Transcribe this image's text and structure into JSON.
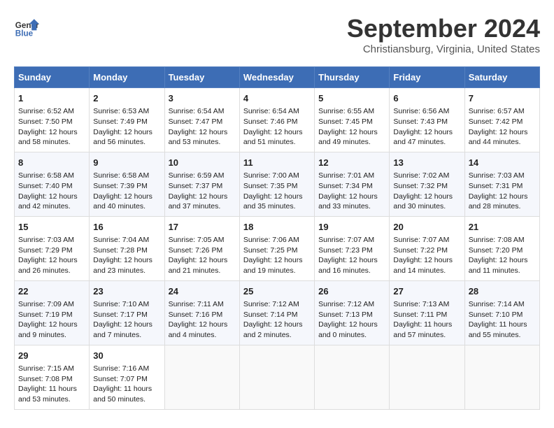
{
  "header": {
    "logo_line1": "General",
    "logo_line2": "Blue",
    "month": "September 2024",
    "location": "Christiansburg, Virginia, United States"
  },
  "days_of_week": [
    "Sunday",
    "Monday",
    "Tuesday",
    "Wednesday",
    "Thursday",
    "Friday",
    "Saturday"
  ],
  "weeks": [
    [
      {
        "num": "1",
        "lines": [
          "Sunrise: 6:52 AM",
          "Sunset: 7:50 PM",
          "Daylight: 12 hours",
          "and 58 minutes."
        ]
      },
      {
        "num": "2",
        "lines": [
          "Sunrise: 6:53 AM",
          "Sunset: 7:49 PM",
          "Daylight: 12 hours",
          "and 56 minutes."
        ]
      },
      {
        "num": "3",
        "lines": [
          "Sunrise: 6:54 AM",
          "Sunset: 7:47 PM",
          "Daylight: 12 hours",
          "and 53 minutes."
        ]
      },
      {
        "num": "4",
        "lines": [
          "Sunrise: 6:54 AM",
          "Sunset: 7:46 PM",
          "Daylight: 12 hours",
          "and 51 minutes."
        ]
      },
      {
        "num": "5",
        "lines": [
          "Sunrise: 6:55 AM",
          "Sunset: 7:45 PM",
          "Daylight: 12 hours",
          "and 49 minutes."
        ]
      },
      {
        "num": "6",
        "lines": [
          "Sunrise: 6:56 AM",
          "Sunset: 7:43 PM",
          "Daylight: 12 hours",
          "and 47 minutes."
        ]
      },
      {
        "num": "7",
        "lines": [
          "Sunrise: 6:57 AM",
          "Sunset: 7:42 PM",
          "Daylight: 12 hours",
          "and 44 minutes."
        ]
      }
    ],
    [
      {
        "num": "8",
        "lines": [
          "Sunrise: 6:58 AM",
          "Sunset: 7:40 PM",
          "Daylight: 12 hours",
          "and 42 minutes."
        ]
      },
      {
        "num": "9",
        "lines": [
          "Sunrise: 6:58 AM",
          "Sunset: 7:39 PM",
          "Daylight: 12 hours",
          "and 40 minutes."
        ]
      },
      {
        "num": "10",
        "lines": [
          "Sunrise: 6:59 AM",
          "Sunset: 7:37 PM",
          "Daylight: 12 hours",
          "and 37 minutes."
        ]
      },
      {
        "num": "11",
        "lines": [
          "Sunrise: 7:00 AM",
          "Sunset: 7:35 PM",
          "Daylight: 12 hours",
          "and 35 minutes."
        ]
      },
      {
        "num": "12",
        "lines": [
          "Sunrise: 7:01 AM",
          "Sunset: 7:34 PM",
          "Daylight: 12 hours",
          "and 33 minutes."
        ]
      },
      {
        "num": "13",
        "lines": [
          "Sunrise: 7:02 AM",
          "Sunset: 7:32 PM",
          "Daylight: 12 hours",
          "and 30 minutes."
        ]
      },
      {
        "num": "14",
        "lines": [
          "Sunrise: 7:03 AM",
          "Sunset: 7:31 PM",
          "Daylight: 12 hours",
          "and 28 minutes."
        ]
      }
    ],
    [
      {
        "num": "15",
        "lines": [
          "Sunrise: 7:03 AM",
          "Sunset: 7:29 PM",
          "Daylight: 12 hours",
          "and 26 minutes."
        ]
      },
      {
        "num": "16",
        "lines": [
          "Sunrise: 7:04 AM",
          "Sunset: 7:28 PM",
          "Daylight: 12 hours",
          "and 23 minutes."
        ]
      },
      {
        "num": "17",
        "lines": [
          "Sunrise: 7:05 AM",
          "Sunset: 7:26 PM",
          "Daylight: 12 hours",
          "and 21 minutes."
        ]
      },
      {
        "num": "18",
        "lines": [
          "Sunrise: 7:06 AM",
          "Sunset: 7:25 PM",
          "Daylight: 12 hours",
          "and 19 minutes."
        ]
      },
      {
        "num": "19",
        "lines": [
          "Sunrise: 7:07 AM",
          "Sunset: 7:23 PM",
          "Daylight: 12 hours",
          "and 16 minutes."
        ]
      },
      {
        "num": "20",
        "lines": [
          "Sunrise: 7:07 AM",
          "Sunset: 7:22 PM",
          "Daylight: 12 hours",
          "and 14 minutes."
        ]
      },
      {
        "num": "21",
        "lines": [
          "Sunrise: 7:08 AM",
          "Sunset: 7:20 PM",
          "Daylight: 12 hours",
          "and 11 minutes."
        ]
      }
    ],
    [
      {
        "num": "22",
        "lines": [
          "Sunrise: 7:09 AM",
          "Sunset: 7:19 PM",
          "Daylight: 12 hours",
          "and 9 minutes."
        ]
      },
      {
        "num": "23",
        "lines": [
          "Sunrise: 7:10 AM",
          "Sunset: 7:17 PM",
          "Daylight: 12 hours",
          "and 7 minutes."
        ]
      },
      {
        "num": "24",
        "lines": [
          "Sunrise: 7:11 AM",
          "Sunset: 7:16 PM",
          "Daylight: 12 hours",
          "and 4 minutes."
        ]
      },
      {
        "num": "25",
        "lines": [
          "Sunrise: 7:12 AM",
          "Sunset: 7:14 PM",
          "Daylight: 12 hours",
          "and 2 minutes."
        ]
      },
      {
        "num": "26",
        "lines": [
          "Sunrise: 7:12 AM",
          "Sunset: 7:13 PM",
          "Daylight: 12 hours",
          "and 0 minutes."
        ]
      },
      {
        "num": "27",
        "lines": [
          "Sunrise: 7:13 AM",
          "Sunset: 7:11 PM",
          "Daylight: 11 hours",
          "and 57 minutes."
        ]
      },
      {
        "num": "28",
        "lines": [
          "Sunrise: 7:14 AM",
          "Sunset: 7:10 PM",
          "Daylight: 11 hours",
          "and 55 minutes."
        ]
      }
    ],
    [
      {
        "num": "29",
        "lines": [
          "Sunrise: 7:15 AM",
          "Sunset: 7:08 PM",
          "Daylight: 11 hours",
          "and 53 minutes."
        ]
      },
      {
        "num": "30",
        "lines": [
          "Sunrise: 7:16 AM",
          "Sunset: 7:07 PM",
          "Daylight: 11 hours",
          "and 50 minutes."
        ]
      },
      null,
      null,
      null,
      null,
      null
    ]
  ]
}
